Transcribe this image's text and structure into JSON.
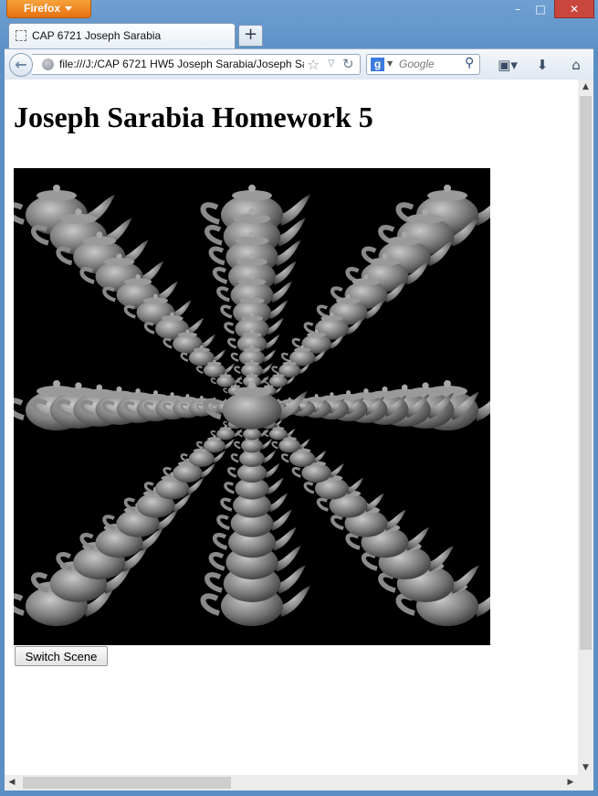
{
  "browser": {
    "menu_button": "Firefox",
    "window_controls": {
      "minimize": "–",
      "maximize": "□",
      "close": "✕"
    },
    "tab": {
      "title": "CAP 6721 Joseph Sarabia",
      "favicon": "blank-page-icon"
    },
    "new_tab": "+",
    "url": "file:///J:/CAP 6721 HW5 Joseph Sarabia/Joseph Sar",
    "search": {
      "engine": "Google",
      "placeholder": "Google"
    }
  },
  "page": {
    "heading": "Joseph Sarabia Homework 5",
    "canvas": {
      "background": "#000000",
      "scene": "teapot-rays"
    },
    "switch_button": "Switch Scene"
  }
}
